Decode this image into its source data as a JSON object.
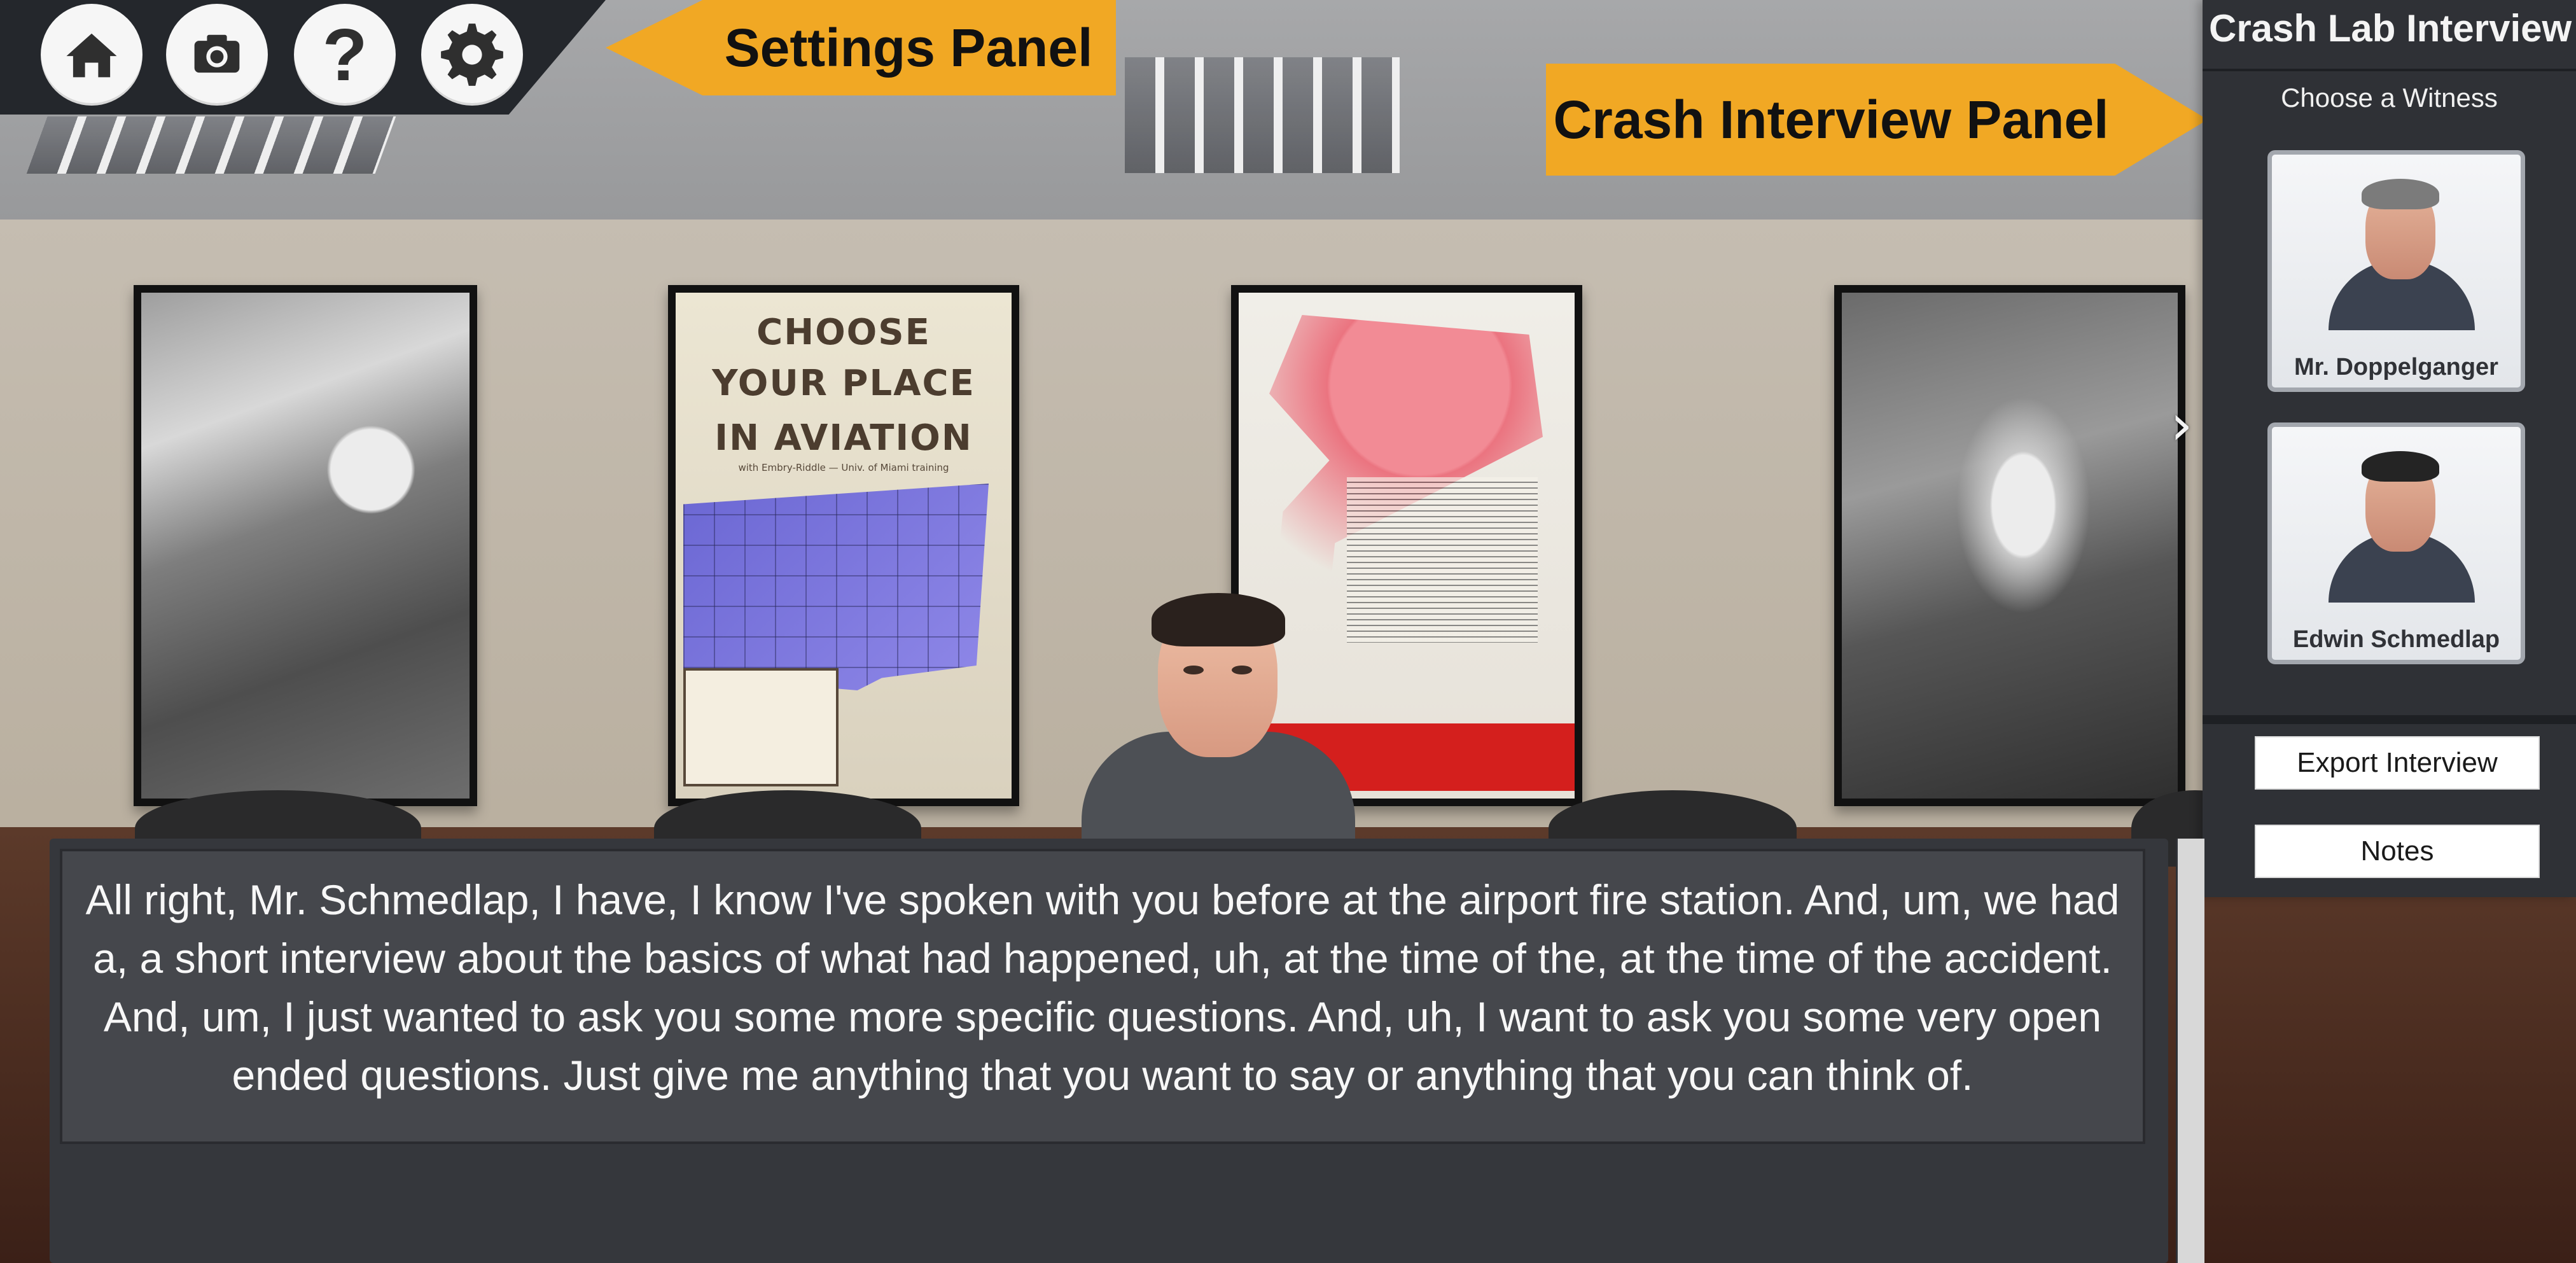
{
  "toolbar": {
    "icons": [
      {
        "name": "home-icon"
      },
      {
        "name": "camera-icon"
      },
      {
        "name": "help-icon",
        "glyph": "?"
      },
      {
        "name": "gear-icon"
      }
    ]
  },
  "callouts": {
    "settings_panel": "Settings Panel",
    "crash_interview_panel": "Crash Interview Panel"
  },
  "interview_panel": {
    "title": "Crash Lab Interview",
    "choose_label": "Choose a Witness",
    "witnesses": [
      {
        "name": "Mr. Doppelganger"
      },
      {
        "name": "Edwin Schmedlap"
      }
    ],
    "buttons": {
      "export": "Export Interview",
      "notes": "Notes"
    },
    "carousel_icon": "chevron-right-icon",
    "carousel_glyph": "›"
  },
  "transcript": {
    "text": "All right, Mr. Schmedlap, I have, I know I've spoken with you before at the airport fire station. And, um, we had a, a short interview about the basics of what had happened, uh, at the time of the, at the time of the accident. And, um, I just wanted to ask you some more specific questions. And, uh, I want to ask you some very open ended questions. Just give me anything that you want to say or anything that you can think of."
  },
  "posters": {
    "choose_title_1": "CHOOSE",
    "choose_title_2": "YOUR PLACE",
    "choose_title_3": "IN AVIATION",
    "choose_subtitle": "with Embry-Riddle — Univ. of Miami training"
  },
  "colors": {
    "callout_orange": "#f1a824",
    "panel_dark": "#2f3136",
    "transcript_background": "#45474c"
  }
}
